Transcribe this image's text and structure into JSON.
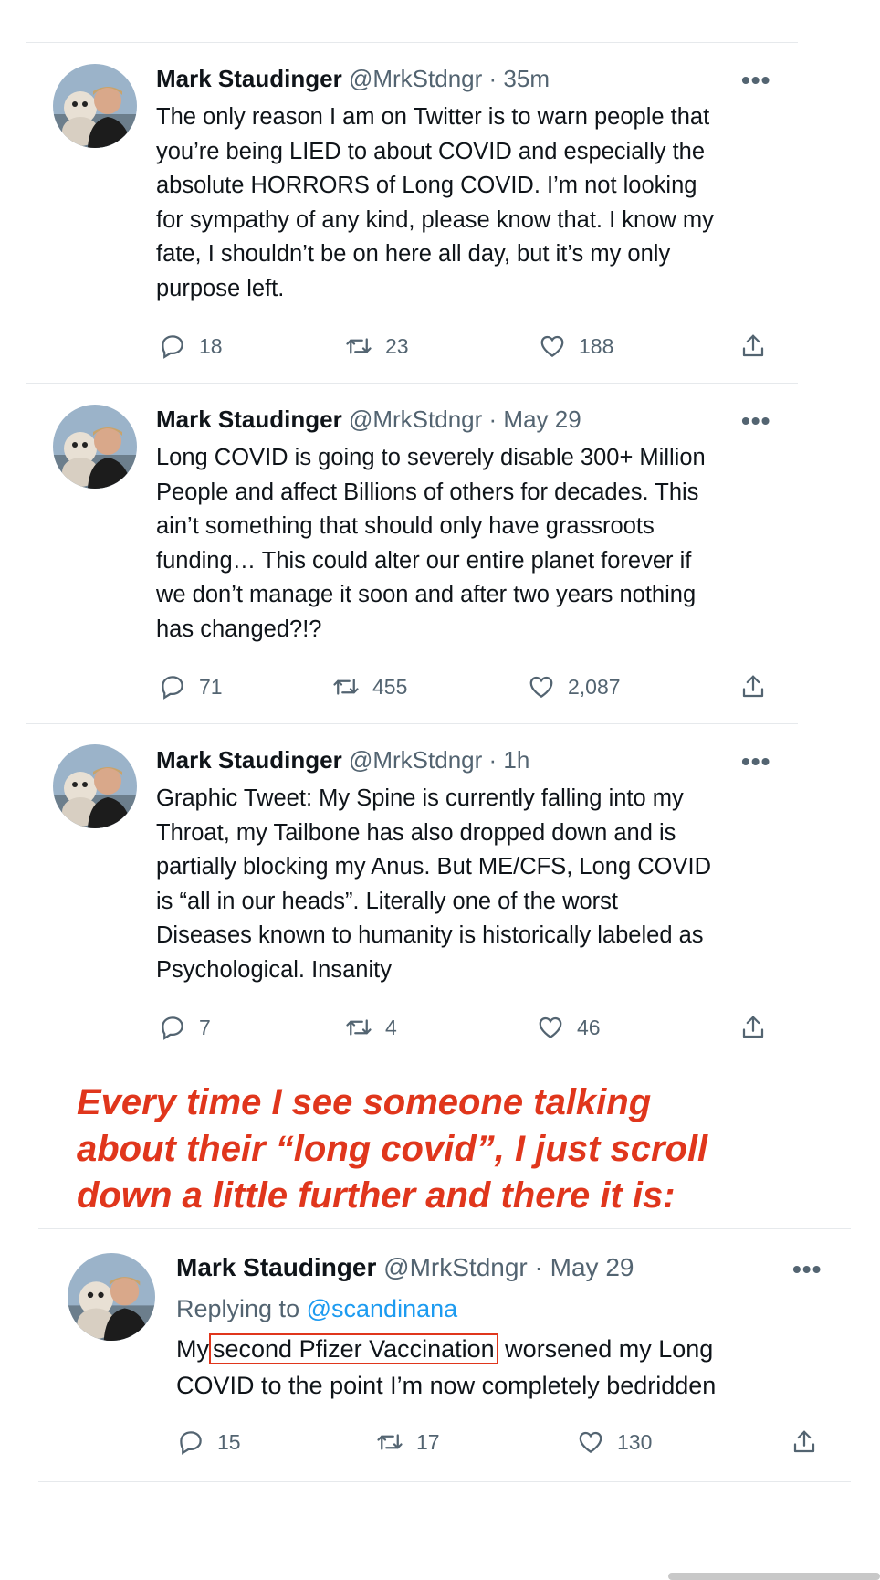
{
  "tweets": [
    {
      "name": "Mark Staudinger",
      "handle": "@MrkStdngr",
      "sep": "·",
      "time": "35m",
      "text": "The only reason I am on Twitter is to warn people that\nyou’re being LIED to about COVID and especially the\nabsolute HORRORS of Long COVID. I’m not looking\nfor sympathy of any kind, please know that. I know my\nfate, I shouldn’t be on here all day, but it’s my only\npurpose left.",
      "replies": "18",
      "retweets": "23",
      "likes": "188"
    },
    {
      "name": "Mark Staudinger",
      "handle": "@MrkStdngr",
      "sep": "·",
      "time": "May 29",
      "text": "Long COVID is going to severely disable 300+ Million\nPeople and affect Billions of others for decades. This\nain’t something that should only have grassroots\nfunding… This could alter our entire planet forever if\nwe don’t manage it soon and after two years nothing\nhas changed?!?",
      "replies": "71",
      "retweets": "455",
      "likes": "2,087"
    },
    {
      "name": "Mark Staudinger",
      "handle": "@MrkStdngr",
      "sep": "·",
      "time": "1h",
      "text": "Graphic Tweet: My Spine is currently falling into my\nThroat, my Tailbone has also dropped down and is\npartially blocking my Anus. But ME/CFS, Long COVID\nis “all in our heads”. Literally one of the worst\nDiseases known to humanity is historically labeled as\nPsychological. Insanity",
      "replies": "7",
      "retweets": "4",
      "likes": "46"
    }
  ],
  "caption": "Every time I see someone talking\nabout their “long covid”, I just scroll\ndown a little further and there it is:",
  "reply_tweet": {
    "name": "Mark Staudinger",
    "handle": "@MrkStdngr",
    "sep": "·",
    "time": "May 29",
    "replying_label": "Replying to",
    "replying_handle": "@scandinana",
    "text_before": "My",
    "text_highlight": "second Pfizer Vaccination",
    "text_after": " worsened my Long",
    "text_line2": "COVID to the point I’m now completely bedridden",
    "replies": "15",
    "retweets": "17",
    "likes": "130"
  },
  "more_glyph": "•••",
  "colors": {
    "caption": "#e0361c",
    "muted": "#536471",
    "link": "#1d9bf0"
  },
  "icons": [
    "reply-icon",
    "retweet-icon",
    "like-icon",
    "share-icon",
    "more-icon"
  ]
}
